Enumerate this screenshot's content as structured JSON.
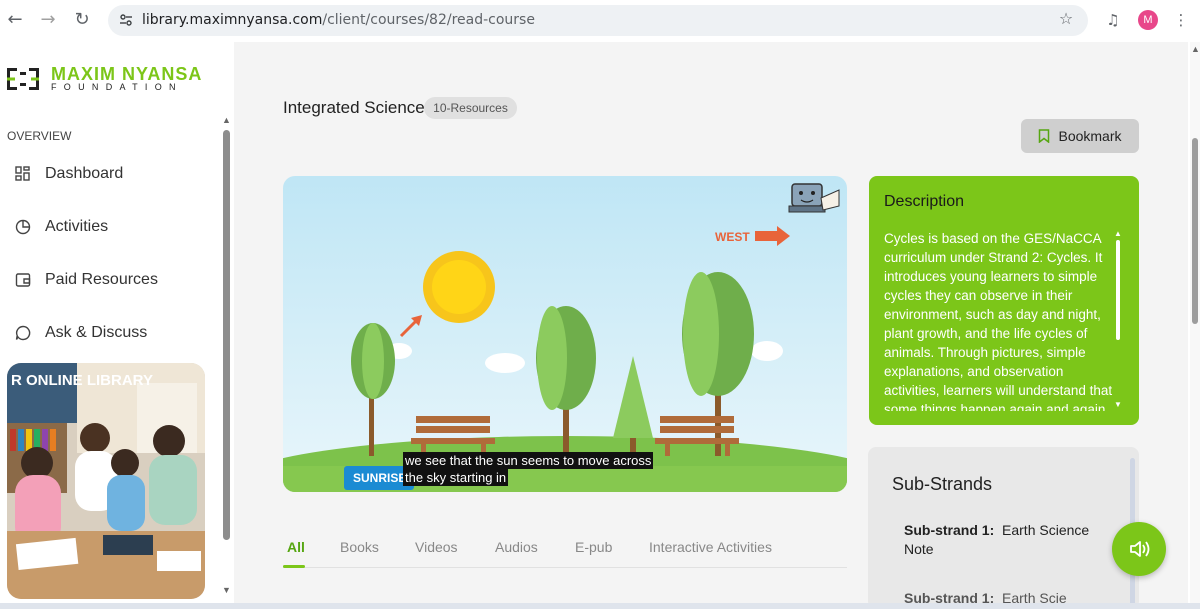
{
  "browser": {
    "url_host": "library.maximnyansa.com",
    "url_path": "/client/courses/82/read-course",
    "profile_initial": "M"
  },
  "sidebar": {
    "brand_name": "MAXIM NYANSA",
    "brand_sub": "FOUNDATION",
    "section_label": "OVERVIEW",
    "items": [
      {
        "label": "Dashboard",
        "icon": "grid-icon"
      },
      {
        "label": "Activities",
        "icon": "pie-chart-icon"
      },
      {
        "label": "Paid Resources",
        "icon": "wallet-icon"
      },
      {
        "label": "Ask & Discuss",
        "icon": "chat-bubble-icon"
      }
    ],
    "promo_sign": "R ONLINE LIBRARY"
  },
  "course": {
    "title": "Integrated Science",
    "resources_badge": "10-Resources",
    "bookmark_label": "Bookmark"
  },
  "video": {
    "caption_line1": "we see that the sun seems to move across",
    "caption_line2": "the sky starting in",
    "west_label": "WEST",
    "sunrise_label": "SUNRISE"
  },
  "tabs": [
    "All",
    "Books",
    "Videos",
    "Audios",
    "E-pub",
    "Interactive Activities"
  ],
  "active_tab": "All",
  "description": {
    "title": "Description",
    "body": "Cycles is based on the GES/NaCCA curriculum under Strand 2: Cycles. It introduces young learners to simple cycles they can observe in their environment, such as day and night, plant growth, and the life cycles of animals. Through pictures, simple explanations, and observation activities, learners will understand that some things happen again and again in a regular order."
  },
  "substrands": {
    "title": "Sub-Strands",
    "items": [
      {
        "label": "Sub-strand 1:",
        "value": "Earth Science Note"
      },
      {
        "label": "Sub-strand 1:",
        "value": "Earth Scie"
      }
    ]
  },
  "colors": {
    "brand_green": "#7cc619",
    "sunrise_blue": "#1b8bd3",
    "west_orange": "#e8643a"
  }
}
